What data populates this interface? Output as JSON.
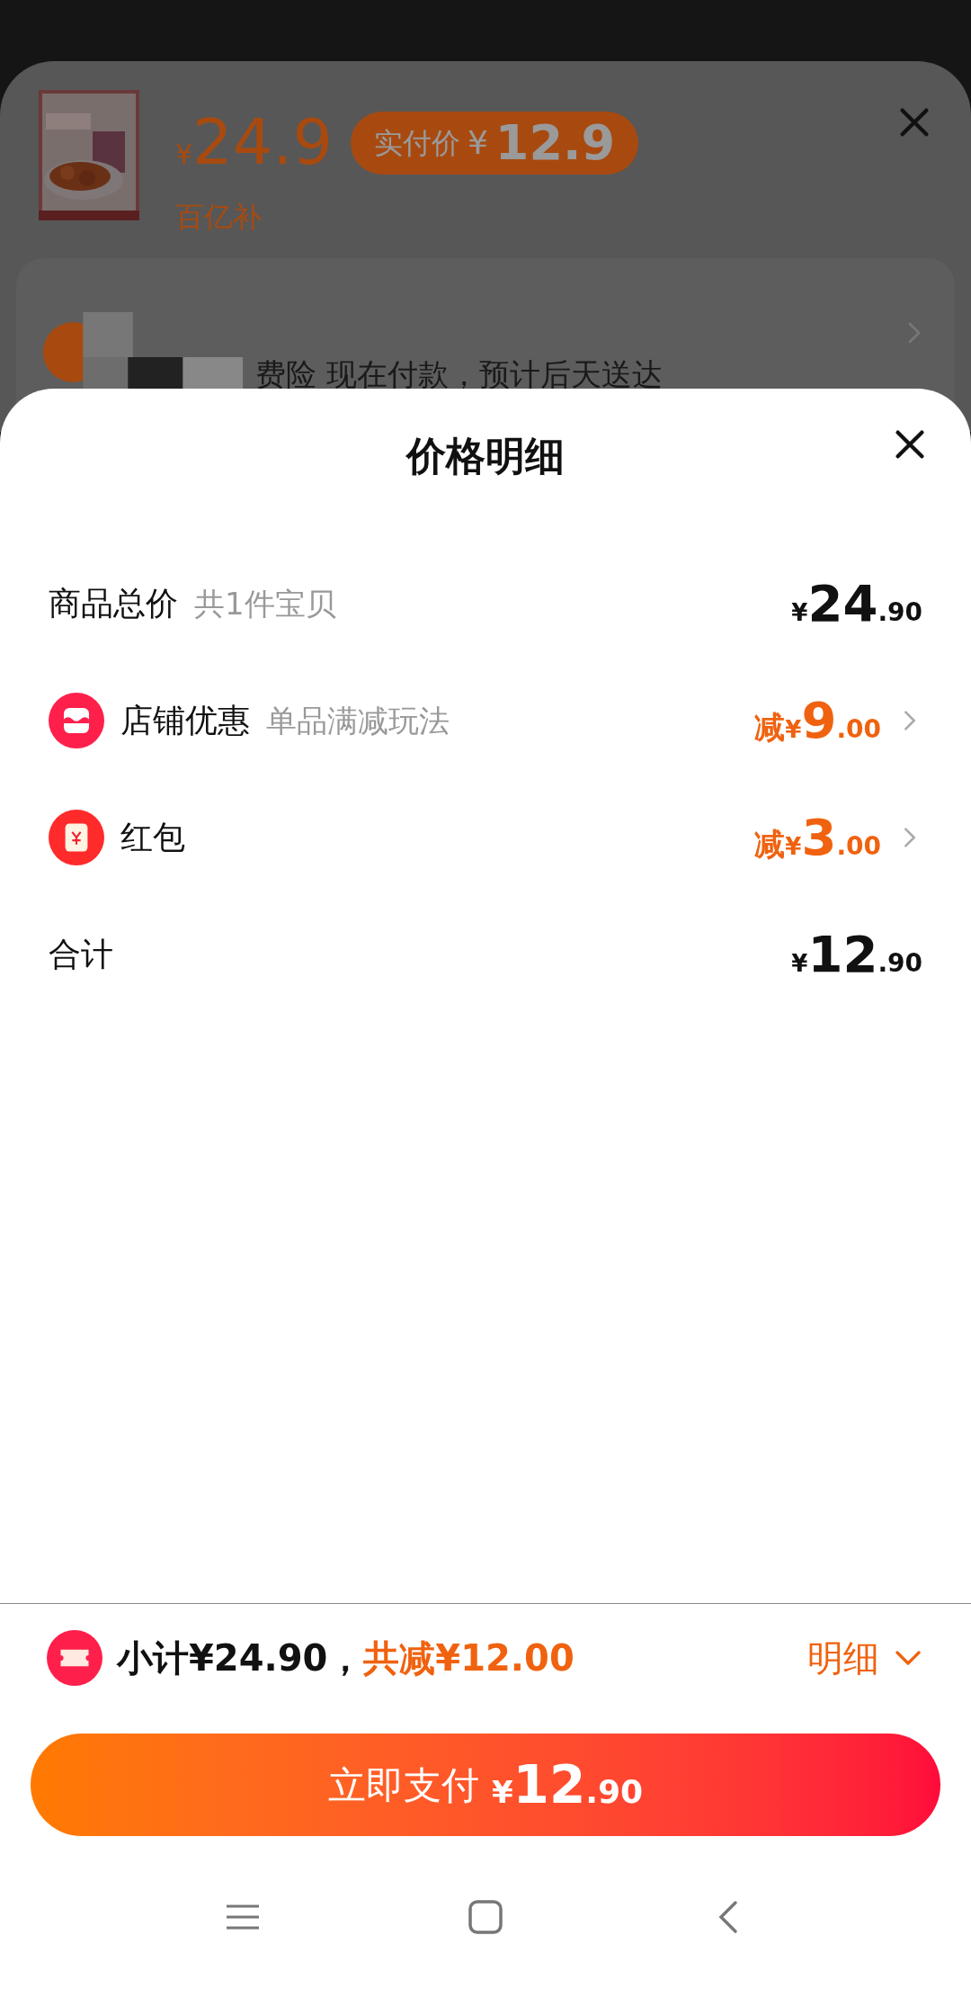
{
  "background_sheet": {
    "price": {
      "currency": "¥",
      "amount": "24.9"
    },
    "pay_badge": {
      "label": "实付价",
      "currency": "¥",
      "amount": "12.9"
    },
    "subsidy_tag": "百亿补",
    "delivery_text": "费险 现在付款，预计后天送达"
  },
  "price_detail": {
    "title": "价格明细",
    "rows": [
      {
        "kind": "plain",
        "label": "商品总价",
        "note": "共1件宝贝",
        "prefix": "",
        "currency": "¥",
        "integer": "24",
        "decimal": ".90",
        "discount": false
      },
      {
        "kind": "shop",
        "label": "店铺优惠",
        "note": "单品满减玩法",
        "prefix": "减",
        "currency": "¥",
        "integer": "9",
        "decimal": ".00",
        "discount": true
      },
      {
        "kind": "redpacket",
        "label": "红包",
        "note": "",
        "prefix": "减",
        "currency": "¥",
        "integer": "3",
        "decimal": ".00",
        "discount": true
      },
      {
        "kind": "plain",
        "label": "合计",
        "note": "",
        "prefix": "",
        "currency": "¥",
        "integer": "12",
        "decimal": ".90",
        "discount": false
      }
    ]
  },
  "summary": {
    "subtotal": "小计¥24.90，",
    "saved": "共减¥12.00",
    "detail_link": "明细",
    "expanded": true
  },
  "pay_button": {
    "label": "立即支付",
    "currency": "¥",
    "integer": "12",
    "decimal": ".90"
  }
}
